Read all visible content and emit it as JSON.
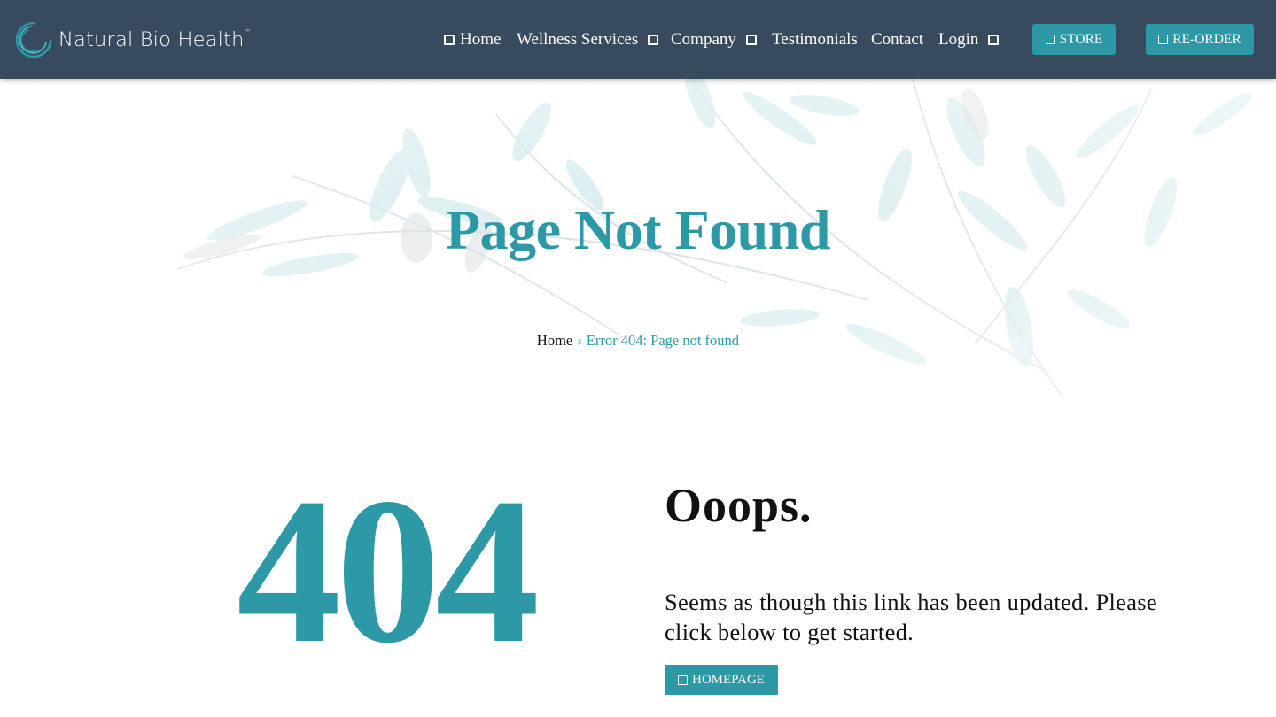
{
  "brand": {
    "name": "Natural Bio Health",
    "trademark": "™",
    "accent": "#2d99a7",
    "header_bg": "#374a5e"
  },
  "nav": {
    "home": {
      "label": "Home",
      "icon": "square-outline-icon"
    },
    "wellness": {
      "label": "Wellness Services",
      "icon": "square-outline-icon"
    },
    "company": {
      "label": "Company",
      "icon": "square-outline-icon"
    },
    "testimonials": {
      "label": "Testimonials"
    },
    "contact": {
      "label": "Contact"
    },
    "login": {
      "label": "Login",
      "icon": "square-outline-icon"
    },
    "store": {
      "label": "STORE",
      "icon": "square-outline-icon"
    },
    "reorder": {
      "label": "RE-ORDER",
      "icon": "square-outline-icon"
    }
  },
  "hero": {
    "title": "Page Not Found",
    "breadcrumb": {
      "home": "Home",
      "separator": "›",
      "current": "Error 404: Page not found"
    }
  },
  "error": {
    "code": "404",
    "heading": "Ooops.",
    "message": "Seems as though this link has been updated. Please click below to get started.",
    "button": {
      "label": "HOMEPAGE",
      "icon": "square-outline-icon"
    }
  }
}
